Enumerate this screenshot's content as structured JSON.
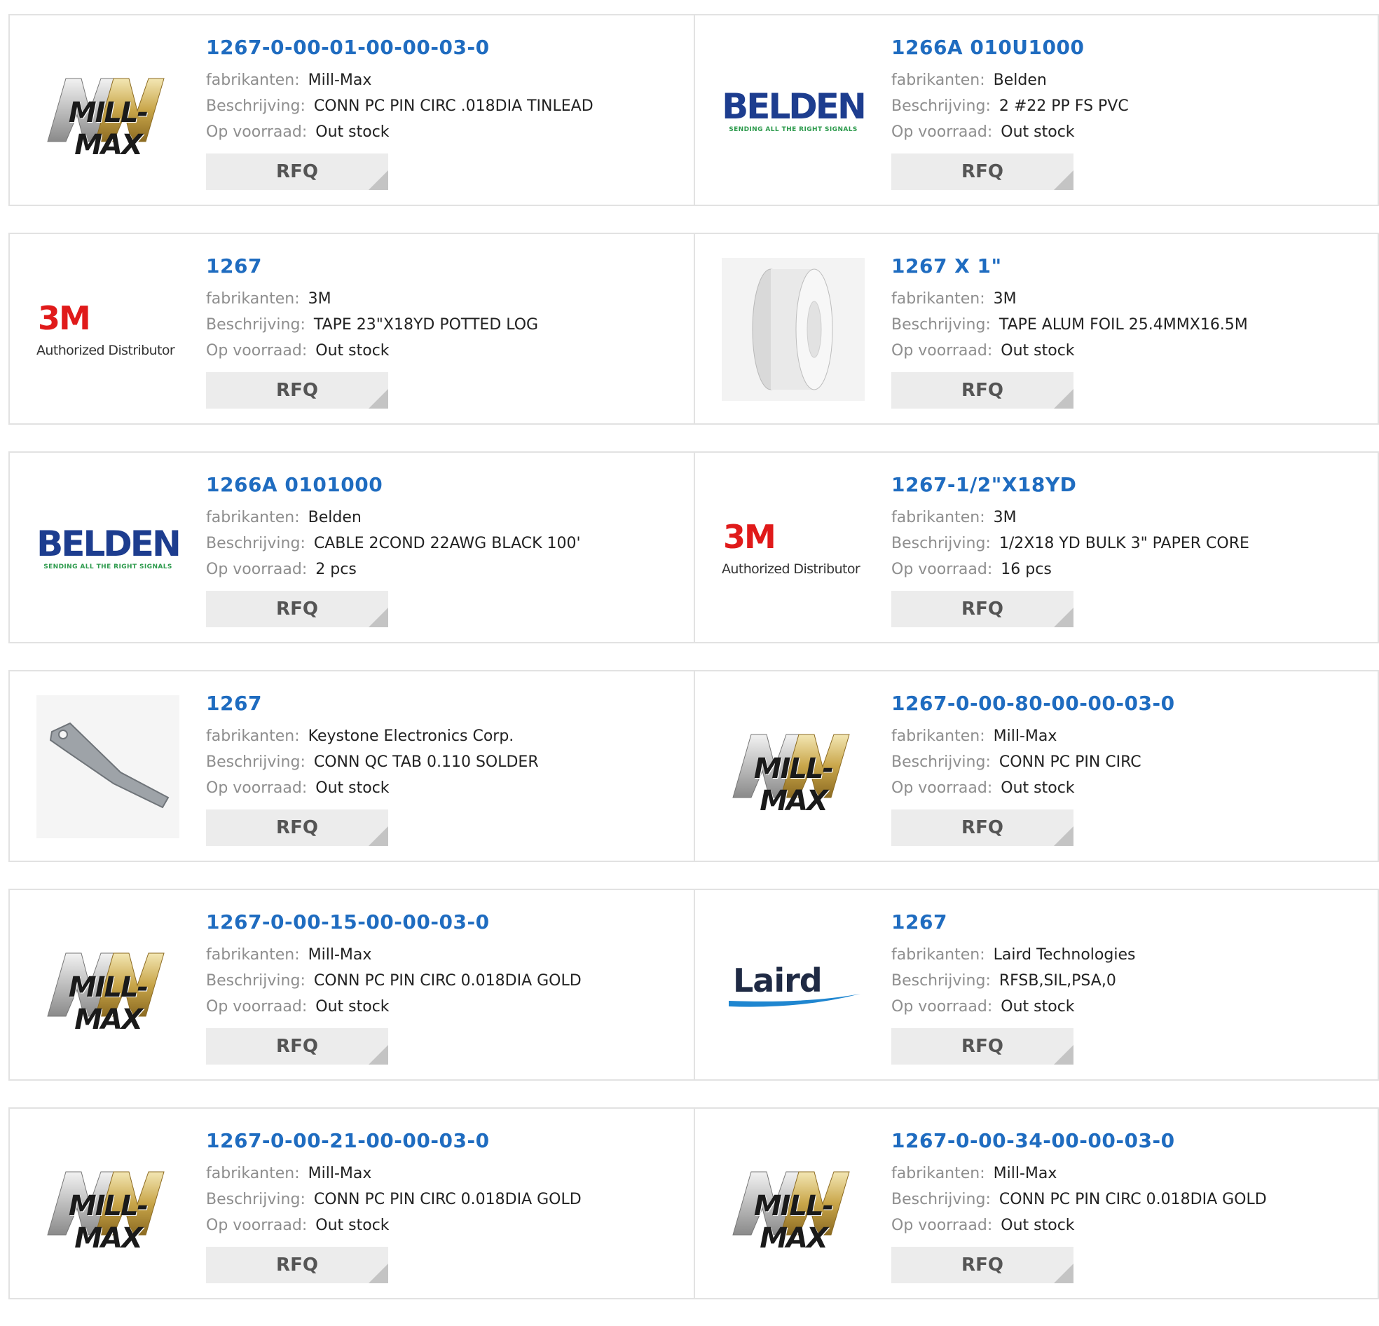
{
  "labels": {
    "manufacturer": "fabrikanten:",
    "description": "Beschrijving:",
    "stock": "Op voorraad:",
    "rfq": "RFQ"
  },
  "logos": {
    "millmax": "MILL-MAX",
    "belden": "BELDEN",
    "belden_tagline": "SENDING ALL THE RIGHT SIGNALS",
    "m3": "3M",
    "m3_tagline": "Authorized Distributor",
    "laird": "Laird"
  },
  "colors": {
    "link": "#1f6cc0",
    "label": "#8e8e8e",
    "button_bg": "#ececec"
  },
  "products": [
    {
      "part": "1267-0-00-01-00-00-03-0",
      "manufacturer": "Mill-Max",
      "description": "CONN PC PIN CIRC .018DIA TINLEAD",
      "stock": "Out stock",
      "logo": "millmax"
    },
    {
      "part": "1266A 010U1000",
      "manufacturer": "Belden",
      "description": "2 #22 PP FS PVC",
      "stock": "Out stock",
      "logo": "belden"
    },
    {
      "part": "1267",
      "manufacturer": "3M",
      "description": "TAPE 23\"X18YD POTTED LOG",
      "stock": "Out stock",
      "logo": "3m"
    },
    {
      "part": "1267 X 1\"",
      "manufacturer": "3M",
      "description": "TAPE ALUM FOIL 25.4MMX16.5M",
      "stock": "Out stock",
      "logo": "tape-photo"
    },
    {
      "part": "1266A 0101000",
      "manufacturer": "Belden",
      "description": "CABLE 2COND 22AWG BLACK 100'",
      "stock": "2 pcs",
      "logo": "belden"
    },
    {
      "part": "1267-1/2\"X18YD",
      "manufacturer": "3M",
      "description": "1/2X18 YD BULK 3\" PAPER CORE",
      "stock": "16 pcs",
      "logo": "3m"
    },
    {
      "part": "1267",
      "manufacturer": "Keystone Electronics Corp.",
      "description": "CONN QC TAB 0.110 SOLDER",
      "stock": "Out stock",
      "logo": "tab-photo"
    },
    {
      "part": "1267-0-00-80-00-00-03-0",
      "manufacturer": "Mill-Max",
      "description": "CONN PC PIN CIRC",
      "stock": "Out stock",
      "logo": "millmax"
    },
    {
      "part": "1267-0-00-15-00-00-03-0",
      "manufacturer": "Mill-Max",
      "description": "CONN PC PIN CIRC 0.018DIA GOLD",
      "stock": "Out stock",
      "logo": "millmax"
    },
    {
      "part": "1267",
      "manufacturer": "Laird Technologies",
      "description": "RFSB,SIL,PSA,0",
      "stock": "Out stock",
      "logo": "laird"
    },
    {
      "part": "1267-0-00-21-00-00-03-0",
      "manufacturer": "Mill-Max",
      "description": "CONN PC PIN CIRC 0.018DIA GOLD",
      "stock": "Out stock",
      "logo": "millmax"
    },
    {
      "part": "1267-0-00-34-00-00-03-0",
      "manufacturer": "Mill-Max",
      "description": "CONN PC PIN CIRC 0.018DIA GOLD",
      "stock": "Out stock",
      "logo": "millmax"
    }
  ]
}
